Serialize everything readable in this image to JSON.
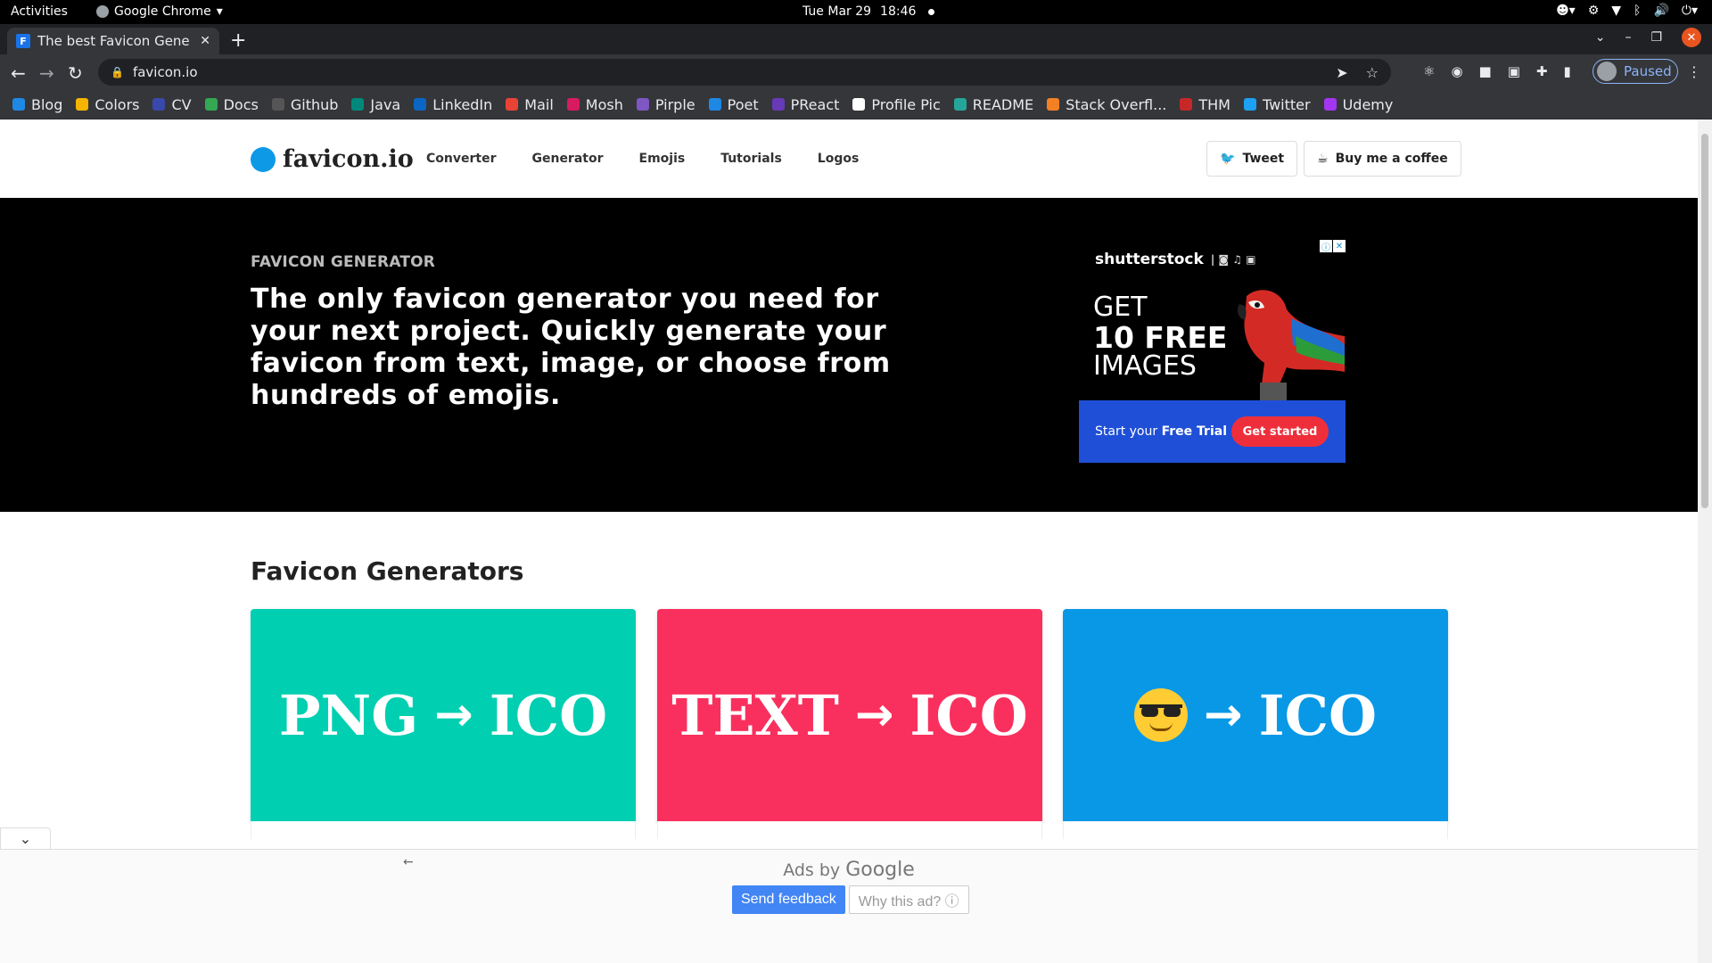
{
  "system": {
    "activities": "Activities",
    "app_name": "Google Chrome",
    "date": "Tue Mar 29",
    "time": "18:46"
  },
  "browser": {
    "tab_title": "The best Favicon Gene",
    "tab_favicon_letter": "F",
    "url": "favicon.io",
    "profile_label": "Paused",
    "bookmarks": [
      {
        "label": "Blog",
        "color": "#1e88e5"
      },
      {
        "label": "Colors",
        "color": "#f4b400"
      },
      {
        "label": "CV",
        "color": "#3949ab"
      },
      {
        "label": "Docs",
        "color": "#34a853"
      },
      {
        "label": "Github",
        "color": "#555555"
      },
      {
        "label": "Java",
        "color": "#00897b"
      },
      {
        "label": "LinkedIn",
        "color": "#0a66c2"
      },
      {
        "label": "Mail",
        "color": "#ea4335"
      },
      {
        "label": "Mosh",
        "color": "#d81b60"
      },
      {
        "label": "Pirple",
        "color": "#7e57c2"
      },
      {
        "label": "Poet",
        "color": "#1e88e5"
      },
      {
        "label": "PReact",
        "color": "#673ab7"
      },
      {
        "label": "Profile Pic",
        "color": "#ffffff"
      },
      {
        "label": "README",
        "color": "#26a69a"
      },
      {
        "label": "Stack Overfl...",
        "color": "#f48024"
      },
      {
        "label": "THM",
        "color": "#c62828"
      },
      {
        "label": "Twitter",
        "color": "#1da1f2"
      },
      {
        "label": "Udemy",
        "color": "#a435f0"
      }
    ]
  },
  "site": {
    "logo_text": "favicon.io",
    "nav": [
      "Converter",
      "Generator",
      "Emojis",
      "Tutorials",
      "Logos"
    ],
    "tweet_label": "Tweet",
    "coffee_label": "Buy me a coffee",
    "hero_eyebrow": "FAVICON GENERATOR",
    "hero_headline": "The only favicon generator you need for your next project. Quickly generate your favicon from text, image, or choose from hundreds of emojis.",
    "section_title": "Favicon Generators",
    "cards": [
      {
        "from": "PNG",
        "arrow": "→",
        "to": "ICO",
        "color": "#00cfb1"
      },
      {
        "from": "TEXT",
        "arrow": "→",
        "to": "ICO",
        "color": "#f9305e"
      },
      {
        "from": "",
        "arrow": "→",
        "to": "ICO",
        "color": "#0898e6"
      }
    ]
  },
  "ad": {
    "brand": "shutterstock",
    "line1": "GET",
    "line2": "10 FREE",
    "line3": "IMAGES",
    "cta_text_pre": "Start your",
    "cta_text_bold": "Free Trial",
    "cta_button": "Get started"
  },
  "bottom_ad": {
    "ads_by": "Ads by",
    "google": "Google",
    "send_feedback": "Send feedback",
    "why_this_ad": "Why this ad? ⓘ"
  },
  "colors": {
    "accent": "#0d99e6",
    "hero_bg": "#000000",
    "ad_blue": "#1f4fd6",
    "ad_red": "#ee2f3b"
  }
}
